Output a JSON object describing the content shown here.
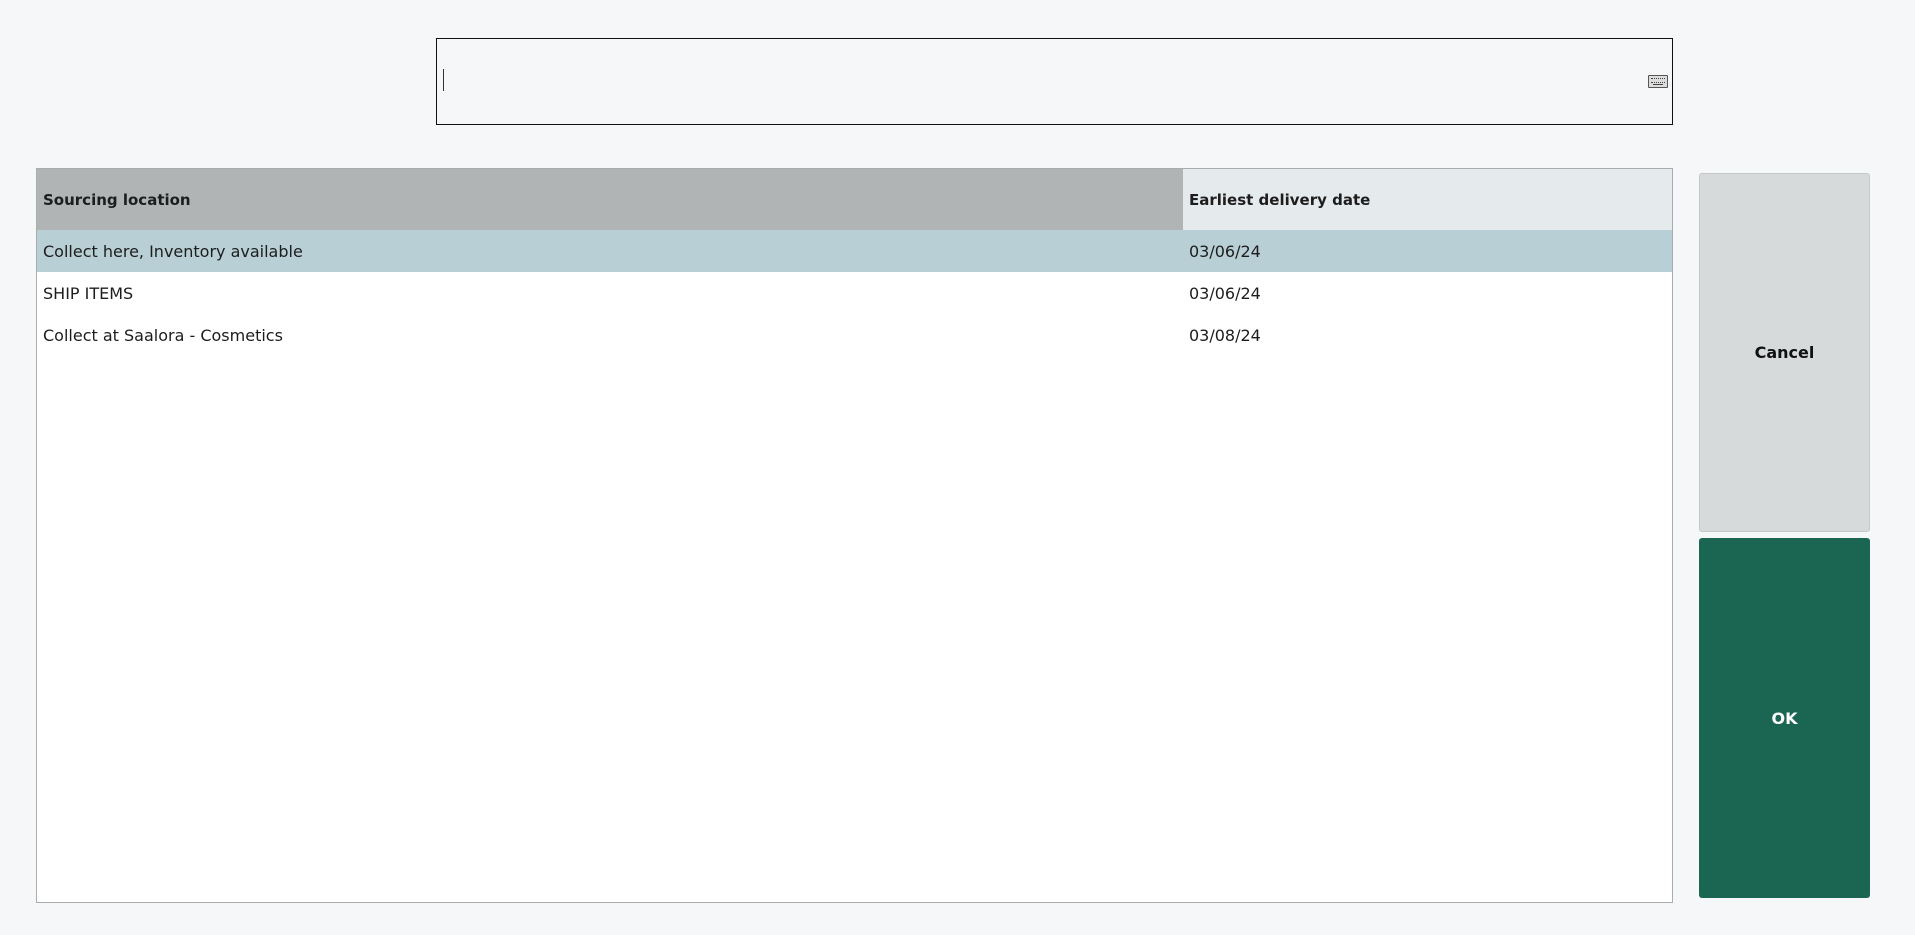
{
  "search": {
    "value": "",
    "icon": "keyboard-icon"
  },
  "table": {
    "columns": [
      "Sourcing location",
      "Earliest delivery date"
    ],
    "rows": [
      {
        "location": "Collect here, Inventory available",
        "date": "03/06/24",
        "selected": true
      },
      {
        "location": "SHIP ITEMS",
        "date": "03/06/24",
        "selected": false
      },
      {
        "location": "Collect at Saalora - Cosmetics",
        "date": "03/08/24",
        "selected": false
      }
    ]
  },
  "buttons": {
    "cancel": "Cancel",
    "ok": "OK"
  },
  "colors": {
    "ok": "#1b6652",
    "selected_row": "#b7cfd5"
  }
}
